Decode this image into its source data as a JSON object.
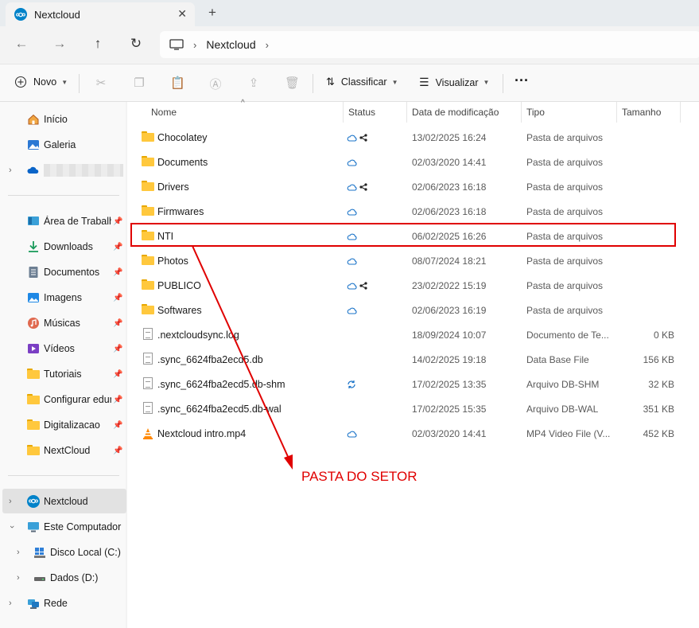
{
  "window": {
    "tab_title": "Nextcloud",
    "close_glyph": "✕",
    "new_tab_glyph": "+"
  },
  "address": {
    "crumb": "Nextcloud",
    "separator": "›"
  },
  "toolbar": {
    "new_label": "Novo",
    "sort_label": "Classificar",
    "view_label": "Visualizar",
    "more_glyph": "···"
  },
  "sidebar": {
    "top": [
      {
        "label": "Início",
        "icon": "home-icon"
      },
      {
        "label": "Galeria",
        "icon": "gallery-icon"
      },
      {
        "label": "",
        "icon": "onedrive-cloud-icon"
      }
    ],
    "pinned": [
      {
        "label": "Área de Trabalho",
        "icon": "desktop-icon"
      },
      {
        "label": "Downloads",
        "icon": "download-icon"
      },
      {
        "label": "Documentos",
        "icon": "documents-icon"
      },
      {
        "label": "Imagens",
        "icon": "pictures-icon"
      },
      {
        "label": "Músicas",
        "icon": "music-icon"
      },
      {
        "label": "Vídeos",
        "icon": "videos-icon"
      },
      {
        "label": "Tutoriais",
        "icon": "folder-icon"
      },
      {
        "label": "Configurar edur",
        "icon": "folder-icon"
      },
      {
        "label": "Digitalizacao",
        "icon": "folder-icon"
      },
      {
        "label": "NextCloud",
        "icon": "folder-icon"
      }
    ],
    "bottom": [
      {
        "label": "Nextcloud",
        "icon": "nextcloud-icon"
      },
      {
        "label": "Este Computador",
        "icon": "pc-icon"
      },
      {
        "label": "Disco Local (C:)",
        "icon": "drive-c-icon"
      },
      {
        "label": "Dados (D:)",
        "icon": "drive-d-icon"
      },
      {
        "label": "Rede",
        "icon": "network-icon"
      }
    ]
  },
  "columns": {
    "name": "Nome",
    "status": "Status",
    "date": "Data de modificação",
    "type": "Tipo",
    "size": "Tamanho"
  },
  "files": [
    {
      "name": "Chocolatey",
      "kind": "folder",
      "status": "cloud-shared",
      "date": "13/02/2025 16:24",
      "type": "Pasta de arquivos",
      "size": ""
    },
    {
      "name": "Documents",
      "kind": "folder",
      "status": "cloud",
      "date": "02/03/2020 14:41",
      "type": "Pasta de arquivos",
      "size": ""
    },
    {
      "name": "Drivers",
      "kind": "folder",
      "status": "cloud-shared",
      "date": "02/06/2023 16:18",
      "type": "Pasta de arquivos",
      "size": ""
    },
    {
      "name": "Firmwares",
      "kind": "folder",
      "status": "cloud",
      "date": "02/06/2023 16:18",
      "type": "Pasta de arquivos",
      "size": ""
    },
    {
      "name": "NTI",
      "kind": "folder",
      "status": "cloud",
      "date": "06/02/2025 16:26",
      "type": "Pasta de arquivos",
      "size": ""
    },
    {
      "name": "Photos",
      "kind": "folder",
      "status": "cloud",
      "date": "08/07/2024 18:21",
      "type": "Pasta de arquivos",
      "size": ""
    },
    {
      "name": "PUBLICO",
      "kind": "folder",
      "status": "cloud-shared",
      "date": "23/02/2022 15:19",
      "type": "Pasta de arquivos",
      "size": ""
    },
    {
      "name": "Softwares",
      "kind": "folder",
      "status": "cloud",
      "date": "02/06/2023 16:19",
      "type": "Pasta de arquivos",
      "size": ""
    },
    {
      "name": ".nextcloudsync.log",
      "kind": "file",
      "status": "",
      "date": "18/09/2024 10:07",
      "type": "Documento de Te...",
      "size": "0 KB"
    },
    {
      "name": ".sync_6624fba2ecd5.db",
      "kind": "file",
      "status": "",
      "date": "14/02/2025 19:18",
      "type": "Data Base File",
      "size": "156 KB"
    },
    {
      "name": ".sync_6624fba2ecd5.db-shm",
      "kind": "file",
      "status": "sync",
      "date": "17/02/2025 13:35",
      "type": "Arquivo DB-SHM",
      "size": "32 KB"
    },
    {
      "name": ".sync_6624fba2ecd5.db-wal",
      "kind": "file",
      "status": "",
      "date": "17/02/2025 15:35",
      "type": "Arquivo DB-WAL",
      "size": "351 KB"
    },
    {
      "name": "Nextcloud intro.mp4",
      "kind": "video",
      "status": "cloud",
      "date": "02/03/2020 14:41",
      "type": "MP4 Video File (V...",
      "size": "452 KB"
    }
  ],
  "annotation": {
    "text": "PASTA DO SETOR",
    "color": "#e00000"
  },
  "colors": {
    "accent": "#0082c9",
    "folder": "#ffc83d",
    "highlight": "#e00000"
  }
}
